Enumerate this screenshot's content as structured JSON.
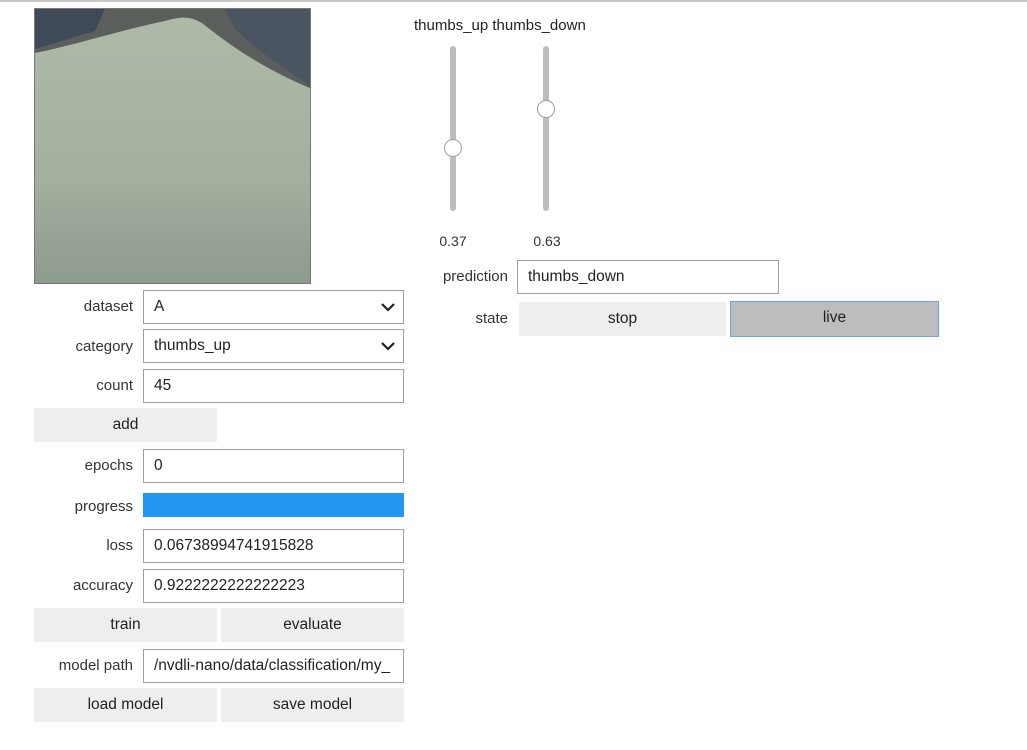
{
  "camera": {
    "icon": "camera-feed-image"
  },
  "form": {
    "dataset": {
      "label": "dataset",
      "value": "A"
    },
    "category": {
      "label": "category",
      "value": "thumbs_up"
    },
    "count": {
      "label": "count",
      "value": "45"
    },
    "add_label": "add",
    "epochs": {
      "label": "epochs",
      "value": "0"
    },
    "progress": {
      "label": "progress",
      "value": 1.0,
      "color": "#2196f3"
    },
    "loss": {
      "label": "loss",
      "value": "0.06738994741915828"
    },
    "accuracy": {
      "label": "accuracy",
      "value": "0.9222222222222223"
    },
    "train_label": "train",
    "evaluate_label": "evaluate",
    "model_path": {
      "label": "model path",
      "value": "/nvdli-nano/data/classification/my_"
    },
    "load_label": "load model",
    "save_label": "save model"
  },
  "sliders": [
    {
      "label": "thumbs_up",
      "value": 0.37,
      "display": "0.37"
    },
    {
      "label": "thumbs_down",
      "value": 0.63,
      "display": "0.63"
    }
  ],
  "prediction": {
    "label": "prediction",
    "value": "thumbs_down"
  },
  "state": {
    "label": "state",
    "stop_label": "stop",
    "live_label": "live",
    "active": "live"
  },
  "colors": {
    "button_bg": "#eeeeee",
    "button_pressed_bg": "#bdbdbd",
    "pressed_border": "#64a8f0",
    "field_border": "#9e9e9e"
  }
}
